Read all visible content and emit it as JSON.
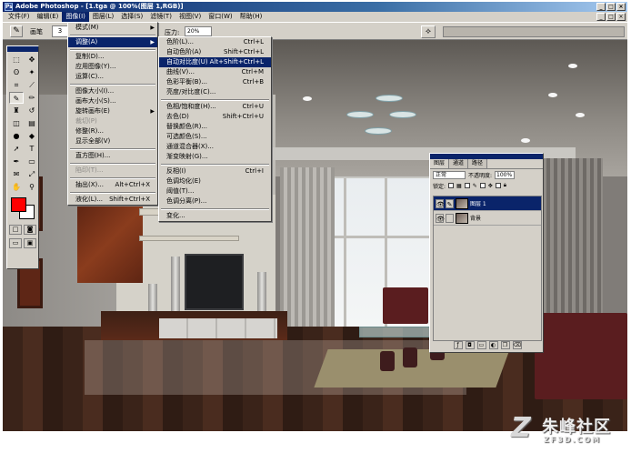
{
  "window": {
    "title": "Adobe Photoshop - [1.tga @ 100%(图层 1,RGB)]",
    "controls": [
      "_",
      "□",
      "×"
    ]
  },
  "menubar": {
    "items": [
      "文件(F)",
      "编辑(E)",
      "图像(I)",
      "图层(L)",
      "选择(S)",
      "滤镜(T)",
      "视图(V)",
      "窗口(W)",
      "帮助(H)"
    ],
    "active_index": 2
  },
  "options": {
    "brush_label": "画笔",
    "brush_size": "3",
    "pressure_label": "压力:",
    "pressure_value": "20%"
  },
  "image_menu": {
    "rows": [
      {
        "label": "模式(M)",
        "shortcut": "",
        "submenu": true,
        "disabled": false,
        "highlight": false
      },
      {
        "sep": true
      },
      {
        "label": "调整(A)",
        "shortcut": "",
        "submenu": true,
        "disabled": false,
        "highlight": true
      },
      {
        "sep": true
      },
      {
        "label": "复制(D)...",
        "shortcut": "",
        "submenu": false,
        "disabled": false,
        "highlight": false
      },
      {
        "label": "应用图像(Y)...",
        "shortcut": "",
        "submenu": false,
        "disabled": false,
        "highlight": false
      },
      {
        "label": "运算(C)...",
        "shortcut": "",
        "submenu": false,
        "disabled": false,
        "highlight": false
      },
      {
        "sep": true
      },
      {
        "label": "图像大小(I)...",
        "shortcut": "",
        "submenu": false,
        "disabled": false,
        "highlight": false
      },
      {
        "label": "画布大小(S)...",
        "shortcut": "",
        "submenu": false,
        "disabled": false,
        "highlight": false
      },
      {
        "label": "旋转画布(E)",
        "shortcut": "",
        "submenu": true,
        "disabled": false,
        "highlight": false
      },
      {
        "label": "裁切(P)",
        "shortcut": "",
        "submenu": false,
        "disabled": true,
        "highlight": false
      },
      {
        "label": "修整(R)...",
        "shortcut": "",
        "submenu": false,
        "disabled": false,
        "highlight": false
      },
      {
        "label": "显示全部(V)",
        "shortcut": "",
        "submenu": false,
        "disabled": false,
        "highlight": false
      },
      {
        "sep": true
      },
      {
        "label": "直方图(H)...",
        "shortcut": "",
        "submenu": false,
        "disabled": false,
        "highlight": false
      },
      {
        "sep": true
      },
      {
        "label": "陷印(T)...",
        "shortcut": "",
        "submenu": false,
        "disabled": true,
        "highlight": false
      },
      {
        "sep": true
      },
      {
        "label": "抽出(X)...",
        "shortcut": "Alt+Ctrl+X",
        "submenu": false,
        "disabled": false,
        "highlight": false
      },
      {
        "sep": true
      },
      {
        "label": "液化(L)...",
        "shortcut": "Shift+Ctrl+X",
        "submenu": false,
        "disabled": false,
        "highlight": false
      }
    ]
  },
  "adjust_menu": {
    "rows": [
      {
        "label": "色阶(L)...",
        "shortcut": "Ctrl+L",
        "highlight": false
      },
      {
        "label": "自动色阶(A)",
        "shortcut": "Shift+Ctrl+L",
        "highlight": false
      },
      {
        "label": "自动对比度(U)",
        "shortcut": "Alt+Shift+Ctrl+L",
        "highlight": true
      },
      {
        "label": "曲线(V)...",
        "shortcut": "Ctrl+M",
        "highlight": false
      },
      {
        "label": "色彩平衡(B)...",
        "shortcut": "Ctrl+B",
        "highlight": false
      },
      {
        "label": "亮度/对比度(C)...",
        "shortcut": "",
        "highlight": false
      },
      {
        "sep": true
      },
      {
        "label": "色相/饱和度(H)...",
        "shortcut": "Ctrl+U",
        "highlight": false
      },
      {
        "label": "去色(D)",
        "shortcut": "Shift+Ctrl+U",
        "highlight": false
      },
      {
        "label": "替换颜色(R)...",
        "shortcut": "",
        "highlight": false
      },
      {
        "label": "可选颜色(S)...",
        "shortcut": "",
        "highlight": false
      },
      {
        "label": "通道混合器(X)...",
        "shortcut": "",
        "highlight": false
      },
      {
        "label": "渐变映射(G)...",
        "shortcut": "",
        "highlight": false
      },
      {
        "sep": true
      },
      {
        "label": "反相(I)",
        "shortcut": "Ctrl+I",
        "highlight": false
      },
      {
        "label": "色调均化(E)",
        "shortcut": "",
        "highlight": false
      },
      {
        "label": "阈值(T)...",
        "shortcut": "",
        "highlight": false
      },
      {
        "label": "色调分离(P)...",
        "shortcut": "",
        "highlight": false
      },
      {
        "sep": true
      },
      {
        "label": "变化...",
        "shortcut": "",
        "highlight": false
      }
    ]
  },
  "layers_palette": {
    "tabs": [
      "图层",
      "通道",
      "路径"
    ],
    "active_tab": 0,
    "blend_mode": "正常",
    "opacity_label": "不透明度:",
    "opacity_value": "100%",
    "lock_label": "锁定:",
    "layers": [
      {
        "name": "图层 1",
        "selected": true
      },
      {
        "name": "背景",
        "selected": false
      }
    ]
  },
  "toolbox": {
    "tools": [
      "marquee-icon",
      "move-icon",
      "lasso-icon",
      "magic-wand-icon",
      "crop-icon",
      "slice-icon",
      "brush-icon",
      "pencil-icon",
      "stamp-icon",
      "history-brush-icon",
      "eraser-icon",
      "gradient-icon",
      "dodge-icon",
      "blur-icon",
      "path-select-icon",
      "type-icon",
      "pen-icon",
      "shape-icon",
      "notes-icon",
      "eyedropper-icon",
      "hand-icon",
      "zoom-icon"
    ],
    "glyphs": [
      "⬚",
      "✥",
      "ʘ",
      "✦",
      "⌗",
      "⟋",
      "✎",
      "✏",
      "♜",
      "↺",
      "◫",
      "▤",
      "●",
      "◆",
      "➚",
      "T",
      "✒",
      "▭",
      "✉",
      "⤢",
      "✋",
      "⚲"
    ],
    "selected_index": 6,
    "foreground_color": "#ff0000",
    "background_color": "#ffffff"
  },
  "watermark": {
    "logo": "Z",
    "title": "朱峰社区",
    "url": "ZF3D.COM"
  }
}
